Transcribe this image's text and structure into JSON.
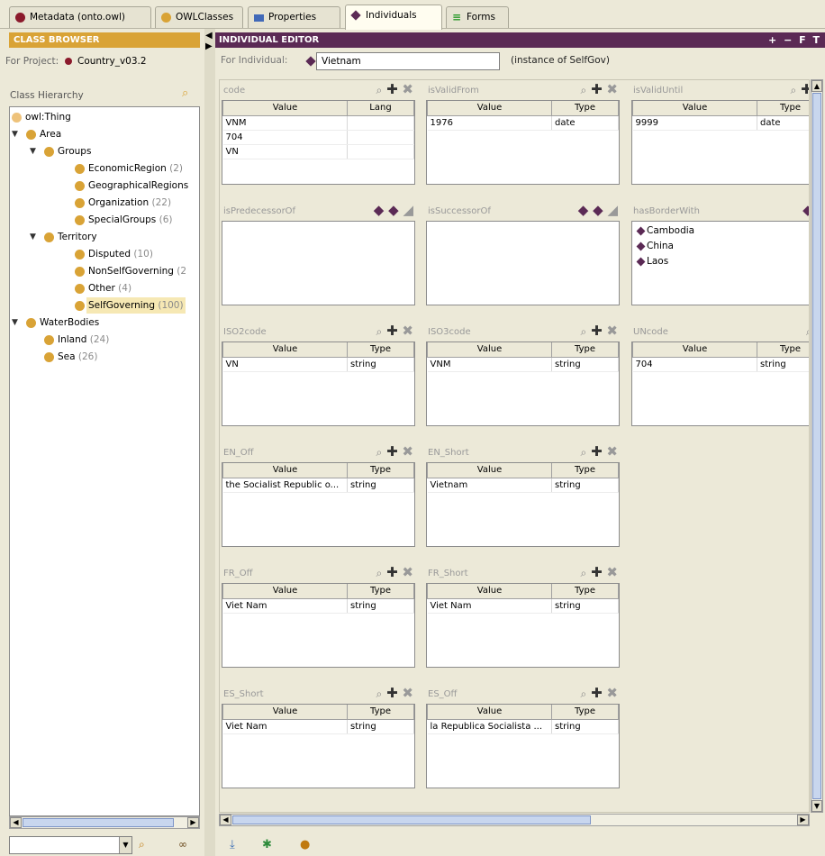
{
  "tabs": [
    {
      "label": "Metadata (onto.owl)",
      "icon": "metadata-icon"
    },
    {
      "label": "OWLClasses",
      "icon": "owl-classes-icon"
    },
    {
      "label": "Properties",
      "icon": "properties-icon"
    },
    {
      "label": "Individuals",
      "icon": "individuals-icon"
    },
    {
      "label": "Forms",
      "icon": "forms-icon"
    }
  ],
  "class_browser": {
    "header": "CLASS BROWSER",
    "project_label": "For Project:",
    "project_name": "Country_v03.2",
    "hierarchy_label": "Class Hierarchy",
    "tree": [
      {
        "label": "owl:Thing",
        "count": ""
      },
      {
        "label": "Area",
        "count": ""
      },
      {
        "label": "Groups",
        "count": ""
      },
      {
        "label": "EconomicRegion",
        "count": "(2)"
      },
      {
        "label": "GeographicalRegions",
        "count": ""
      },
      {
        "label": "Organization",
        "count": "(22)"
      },
      {
        "label": "SpecialGroups",
        "count": "(6)"
      },
      {
        "label": "Territory",
        "count": ""
      },
      {
        "label": "Disputed",
        "count": "(10)"
      },
      {
        "label": "NonSelfGoverning",
        "count": "(2"
      },
      {
        "label": "Other",
        "count": "(4)"
      },
      {
        "label": "SelfGoverning",
        "count": "(100)"
      },
      {
        "label": "WaterBodies",
        "count": ""
      },
      {
        "label": "Inland",
        "count": "(24)"
      },
      {
        "label": "Sea",
        "count": "(26)"
      }
    ]
  },
  "editor": {
    "header": "INDIVIDUAL EDITOR",
    "header_buttons": "+ − F T",
    "for_label": "For Individual:",
    "individual": "Vietnam",
    "instance_of": "(instance of SelfGov)",
    "props": {
      "code": {
        "title": "code",
        "col1": "Value",
        "col2": "Lang",
        "rows": [
          [
            "VNM",
            ""
          ],
          [
            "704",
            ""
          ],
          [
            "VN",
            ""
          ]
        ]
      },
      "isValidFrom": {
        "title": "isValidFrom",
        "col1": "Value",
        "col2": "Type",
        "rows": [
          [
            "1976",
            "date"
          ]
        ]
      },
      "isValidUntil": {
        "title": "isValidUntil",
        "col1": "Value",
        "col2": "Type",
        "rows": [
          [
            "9999",
            "date"
          ]
        ]
      },
      "isPredecessorOf": {
        "title": "isPredecessorOf"
      },
      "isSuccessorOf": {
        "title": "isSuccessorOf"
      },
      "hasBorderWith": {
        "title": "hasBorderWith",
        "items": [
          "Cambodia",
          "China",
          "Laos"
        ]
      },
      "ISO2code": {
        "title": "ISO2code",
        "col1": "Value",
        "col2": "Type",
        "rows": [
          [
            "VN",
            "string"
          ]
        ]
      },
      "ISO3code": {
        "title": "ISO3code",
        "col1": "Value",
        "col2": "Type",
        "rows": [
          [
            "VNM",
            "string"
          ]
        ]
      },
      "UNcode": {
        "title": "UNcode",
        "col1": "Value",
        "col2": "Type",
        "rows": [
          [
            "704",
            "string"
          ]
        ]
      },
      "EN_Off": {
        "title": "EN_Off",
        "col1": "Value",
        "col2": "Type",
        "rows": [
          [
            "the Socialist Republic o...",
            "string"
          ]
        ]
      },
      "EN_Short": {
        "title": "EN_Short",
        "col1": "Value",
        "col2": "Type",
        "rows": [
          [
            "Vietnam",
            "string"
          ]
        ]
      },
      "FR_Off": {
        "title": "FR_Off",
        "col1": "Value",
        "col2": "Type",
        "rows": [
          [
            "Viet Nam",
            "string"
          ]
        ]
      },
      "FR_Short": {
        "title": "FR_Short",
        "col1": "Value",
        "col2": "Type",
        "rows": [
          [
            "Viet Nam",
            "string"
          ]
        ]
      },
      "ES_Short": {
        "title": "ES_Short",
        "col1": "Value",
        "col2": "Type",
        "rows": [
          [
            "Viet Nam",
            "string"
          ]
        ]
      },
      "ES_Off": {
        "title": "ES_Off",
        "col1": "Value",
        "col2": "Type",
        "rows": [
          [
            "la Republica Socialista ...",
            "string"
          ]
        ]
      }
    }
  }
}
